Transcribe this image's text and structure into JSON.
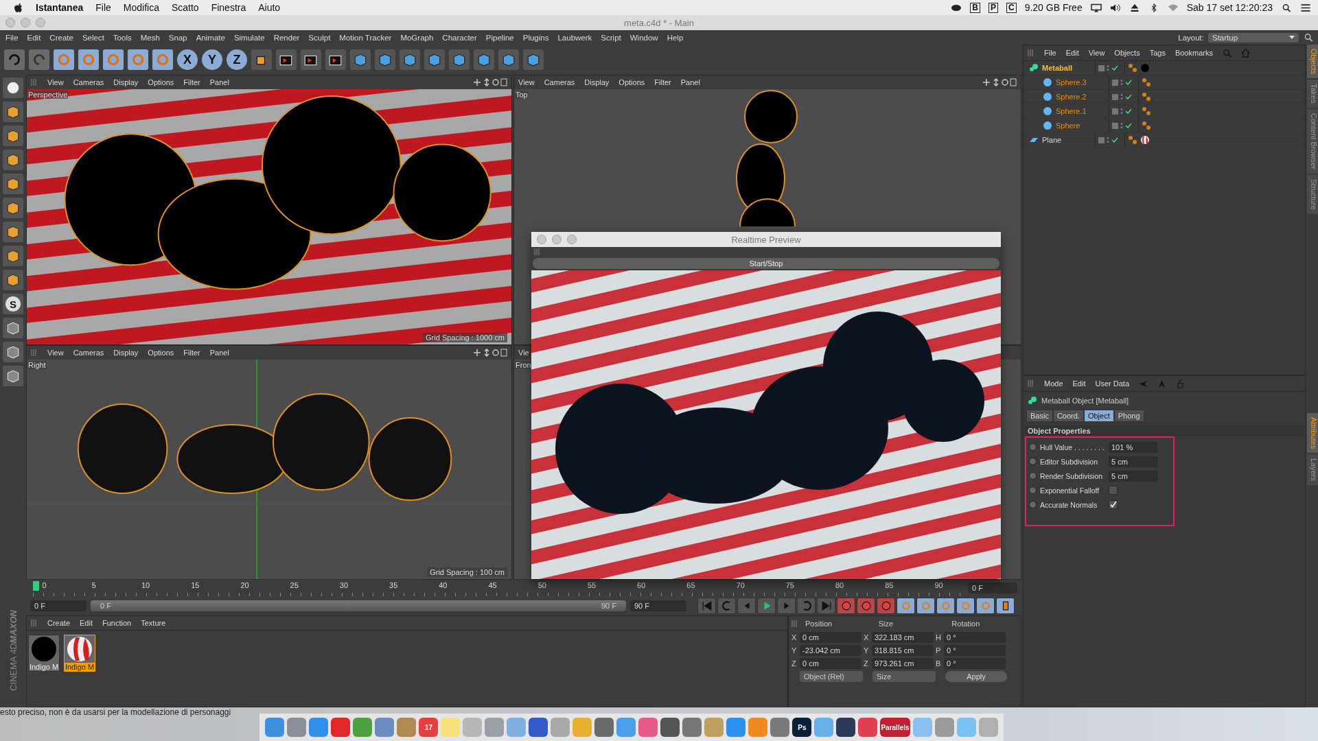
{
  "mac_menubar": {
    "app": "Istantanea",
    "menus": [
      "File",
      "Modifica",
      "Scatto",
      "Finestra",
      "Aiuto"
    ],
    "status_letters": [
      "B",
      "P",
      "C"
    ],
    "disk": "9.20 GB Free",
    "clock": "Sab 17 set  12:20:23"
  },
  "window": {
    "title": "meta.c4d * - Main"
  },
  "menu": [
    "File",
    "Edit",
    "Create",
    "Select",
    "Tools",
    "Mesh",
    "Snap",
    "Animate",
    "Simulate",
    "Render",
    "Sculpt",
    "Motion Tracker",
    "MoGraph",
    "Character",
    "Pipeline",
    "Plugins",
    "Laubwerk",
    "Script",
    "Window",
    "Help"
  ],
  "layout": {
    "label": "Layout:",
    "value": "Startup"
  },
  "axis_buttons": [
    "X",
    "Y",
    "Z"
  ],
  "left_tool_letter": "S",
  "viewports": [
    {
      "kind": "scene",
      "menus": [
        "View",
        "Cameras",
        "Display",
        "Options",
        "Filter",
        "Panel"
      ],
      "label": "Perspective",
      "grid": "Grid Spacing : 1000 cm"
    },
    {
      "kind": "top",
      "menus": [
        "View",
        "Cameras",
        "Display",
        "Options",
        "Filter",
        "Panel"
      ],
      "label": "Top"
    },
    {
      "kind": "side",
      "menus": [
        "View",
        "Cameras",
        "Display",
        "Options",
        "Filter",
        "Panel"
      ],
      "label": "Right",
      "grid": "Grid Spacing : 100 cm"
    },
    {
      "kind": "hidden",
      "menus": [
        "Vie"
      ],
      "label": "Fron"
    }
  ],
  "preview": {
    "title": "Realtime Preview",
    "button": "Start/Stop"
  },
  "timeline": {
    "ticks": [
      "0",
      "5",
      "10",
      "15",
      "20",
      "25",
      "30",
      "35",
      "40",
      "45",
      "50",
      "55",
      "60",
      "65",
      "70",
      "75",
      "80",
      "85",
      "90"
    ],
    "current": "0 F",
    "start": "0 F",
    "range": {
      "level": 1
    },
    "range_start": "0 F",
    "range_end": "90 F",
    "end": "90 F"
  },
  "materials": {
    "menus": [
      "Create",
      "Edit",
      "Function",
      "Texture"
    ],
    "items": [
      {
        "name": "Indigo M",
        "kind": "black",
        "selected": false
      },
      {
        "name": "Indigo M",
        "kind": "striped",
        "selected": true
      }
    ]
  },
  "brand": {
    "line1": "MAXON",
    "line2": "CINEMA 4D"
  },
  "coordinates": {
    "headers": [
      "Position",
      "Size",
      "Rotation"
    ],
    "rows": [
      {
        "axis": "X",
        "position": "0 cm",
        "size_axis": "X",
        "size": "322.183 cm",
        "rot_axis": "H",
        "rotation": "0 °"
      },
      {
        "axis": "Y",
        "position": "-23.042 cm",
        "size_axis": "Y",
        "size": "318.815 cm",
        "rot_axis": "P",
        "rotation": "0 °"
      },
      {
        "axis": "Z",
        "position": "0 cm",
        "size_axis": "Z",
        "size": "973.261 cm",
        "rot_axis": "B",
        "rotation": "0 °"
      }
    ],
    "mode": "Object (Rel)",
    "size_mode": "Size",
    "apply": "Apply"
  },
  "objects": {
    "menus": [
      "File",
      "Edit",
      "View",
      "Objects",
      "Tags",
      "Bookmarks"
    ],
    "tree": [
      {
        "name": "Metaball",
        "kind": "metaball",
        "selected": true,
        "material_tag": {
          "kind": "black"
        },
        "children": [
          {
            "name": "Sphere.3",
            "kind": "sphere",
            "selected": true
          },
          {
            "name": "Sphere.2",
            "kind": "sphere",
            "selected": true
          },
          {
            "name": "Sphere.1",
            "kind": "sphere",
            "selected": true
          },
          {
            "name": "Sphere",
            "kind": "sphere",
            "selected": true
          }
        ]
      },
      {
        "name": "Plane",
        "kind": "plane",
        "selected": false,
        "material_tag": {
          "kind": "striped"
        }
      }
    ]
  },
  "side_tabs_top": [
    {
      "label": "Objects",
      "selected": true
    },
    {
      "label": "Takes",
      "selected": false
    },
    {
      "label": "Content Browser",
      "selected": false
    },
    {
      "label": "Structure",
      "selected": false
    }
  ],
  "side_tabs_bottom": [
    {
      "label": "Attributes",
      "selected": true
    },
    {
      "label": "Layers",
      "selected": false
    }
  ],
  "attributes": {
    "menus": [
      "Mode",
      "Edit",
      "User Data"
    ],
    "title": "Metaball Object [Metaball]",
    "tabs": [
      {
        "label": "Basic",
        "selected": false
      },
      {
        "label": "Coord.",
        "selected": false
      },
      {
        "label": "Object",
        "selected": true
      },
      {
        "label": "Phong",
        "selected": false
      }
    ],
    "section": "Object Properties",
    "properties": [
      {
        "kind": "field",
        "label": "Hull Value . . . . . . . .",
        "value": "101 %",
        "keyframed": false
      },
      {
        "kind": "field",
        "label": "Editor Subdivision",
        "value": "5 cm",
        "keyframed": false
      },
      {
        "kind": "field",
        "label": "Render Subdivision",
        "value": "5 cm",
        "keyframed": false
      },
      {
        "kind": "checkbox",
        "label": "Exponential Falloff",
        "checked": false,
        "keyframed": false
      },
      {
        "kind": "checkbox",
        "label": "Accurate Normals",
        "checked": true,
        "keyframed": false
      }
    ]
  },
  "background_text": "esto preciso, non è da usarsi per la modellazione di personaggi",
  "dock": [
    {
      "color": "#3d8fe0"
    },
    {
      "color": "#8a8f99"
    },
    {
      "color": "#2f8fe8"
    },
    {
      "color": "#e0282a"
    },
    {
      "color": "#4c9e3e"
    },
    {
      "color": "#6b8cc0"
    },
    {
      "color": "#b08a55"
    },
    {
      "color": "#e84040",
      "text": "17"
    },
    {
      "color": "#f6e27a"
    },
    {
      "color": "#b8b8b8"
    },
    {
      "color": "#9aa0a8"
    },
    {
      "color": "#7fb0e0"
    },
    {
      "color": "#3558c8"
    },
    {
      "color": "#a8a8a8"
    },
    {
      "color": "#e8b030"
    },
    {
      "color": "#6a6a6a"
    },
    {
      "color": "#4aa0e8"
    },
    {
      "color": "#e85a8a"
    },
    {
      "color": "#555555"
    },
    {
      "color": "#777777"
    },
    {
      "color": "#c0a060"
    },
    {
      "color": "#2a90f0"
    },
    {
      "color": "#f08a20"
    },
    {
      "color": "#7a7a7a"
    },
    {
      "color": "#0a2038",
      "text": "Ps"
    },
    {
      "color": "#6ab0e8"
    },
    {
      "color": "#2a3a5a"
    },
    {
      "color": "#e04050"
    },
    {
      "color": "#c02030",
      "text": "Parallels"
    },
    {
      "color": "#8ac0f0"
    },
    {
      "color": "#9a9a9a"
    },
    {
      "color": "#7ac0f0"
    },
    {
      "color": "#b0b0b0"
    }
  ]
}
